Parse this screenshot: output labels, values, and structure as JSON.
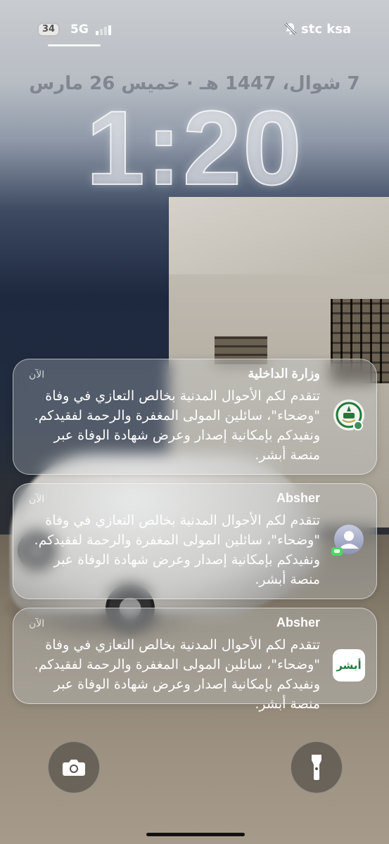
{
  "status_bar": {
    "battery_level": "34",
    "network": "5G",
    "carrier": "stc ksa",
    "icons": [
      "bell-slash-icon",
      "signal-bars-icon"
    ]
  },
  "lock_screen": {
    "date": "7 شوال، 1447 هـ · خميس 26 مارس",
    "time": "1:20"
  },
  "notifications": [
    {
      "title": "وزارة الداخلية",
      "time": "الآن",
      "icon": "moi-emblem-icon",
      "body": [
        "تتقدم لكم الأحوال المدنية بخالص التعازي في وفاة",
        "\"وضحاء\"، سائلين المولى المغفرة والرحمة لفقيدكم.",
        "ونفيدكم بإمكانية إصدار وعرض شهادة الوفاة عبر",
        "منصة أبشر."
      ]
    },
    {
      "title": "Absher",
      "time": "الآن",
      "icon": "contact-avatar-icon",
      "body": [
        "تتقدم لكم الأحوال المدنية بخالص التعازي في وفاة",
        "\"وضحاء\"، سائلين المولى المغفرة والرحمة لفقيدكم.",
        "ونفيدكم بإمكانية إصدار وعرض شهادة الوفاة عبر",
        "منصة أبشر."
      ]
    },
    {
      "title": "Absher",
      "time": "الآن",
      "icon": "absher-app-icon",
      "icon_text": "أبشر",
      "body": [
        "تتقدم لكم الأحوال المدنية بخالص التعازي في وفاة",
        "\"وضحاء\"، سائلين المولى المغفرة والرحمة لفقيدكم.",
        "ونفيدكم بإمكانية إصدار وعرض شهادة الوفاة عبر",
        "منصة أبشر."
      ]
    }
  ],
  "quick_actions": {
    "left": "camera-icon",
    "right": "flashlight-icon"
  },
  "colors": {
    "absher_green": "#1f7a3a",
    "notification_bg": "#d2d6de"
  }
}
